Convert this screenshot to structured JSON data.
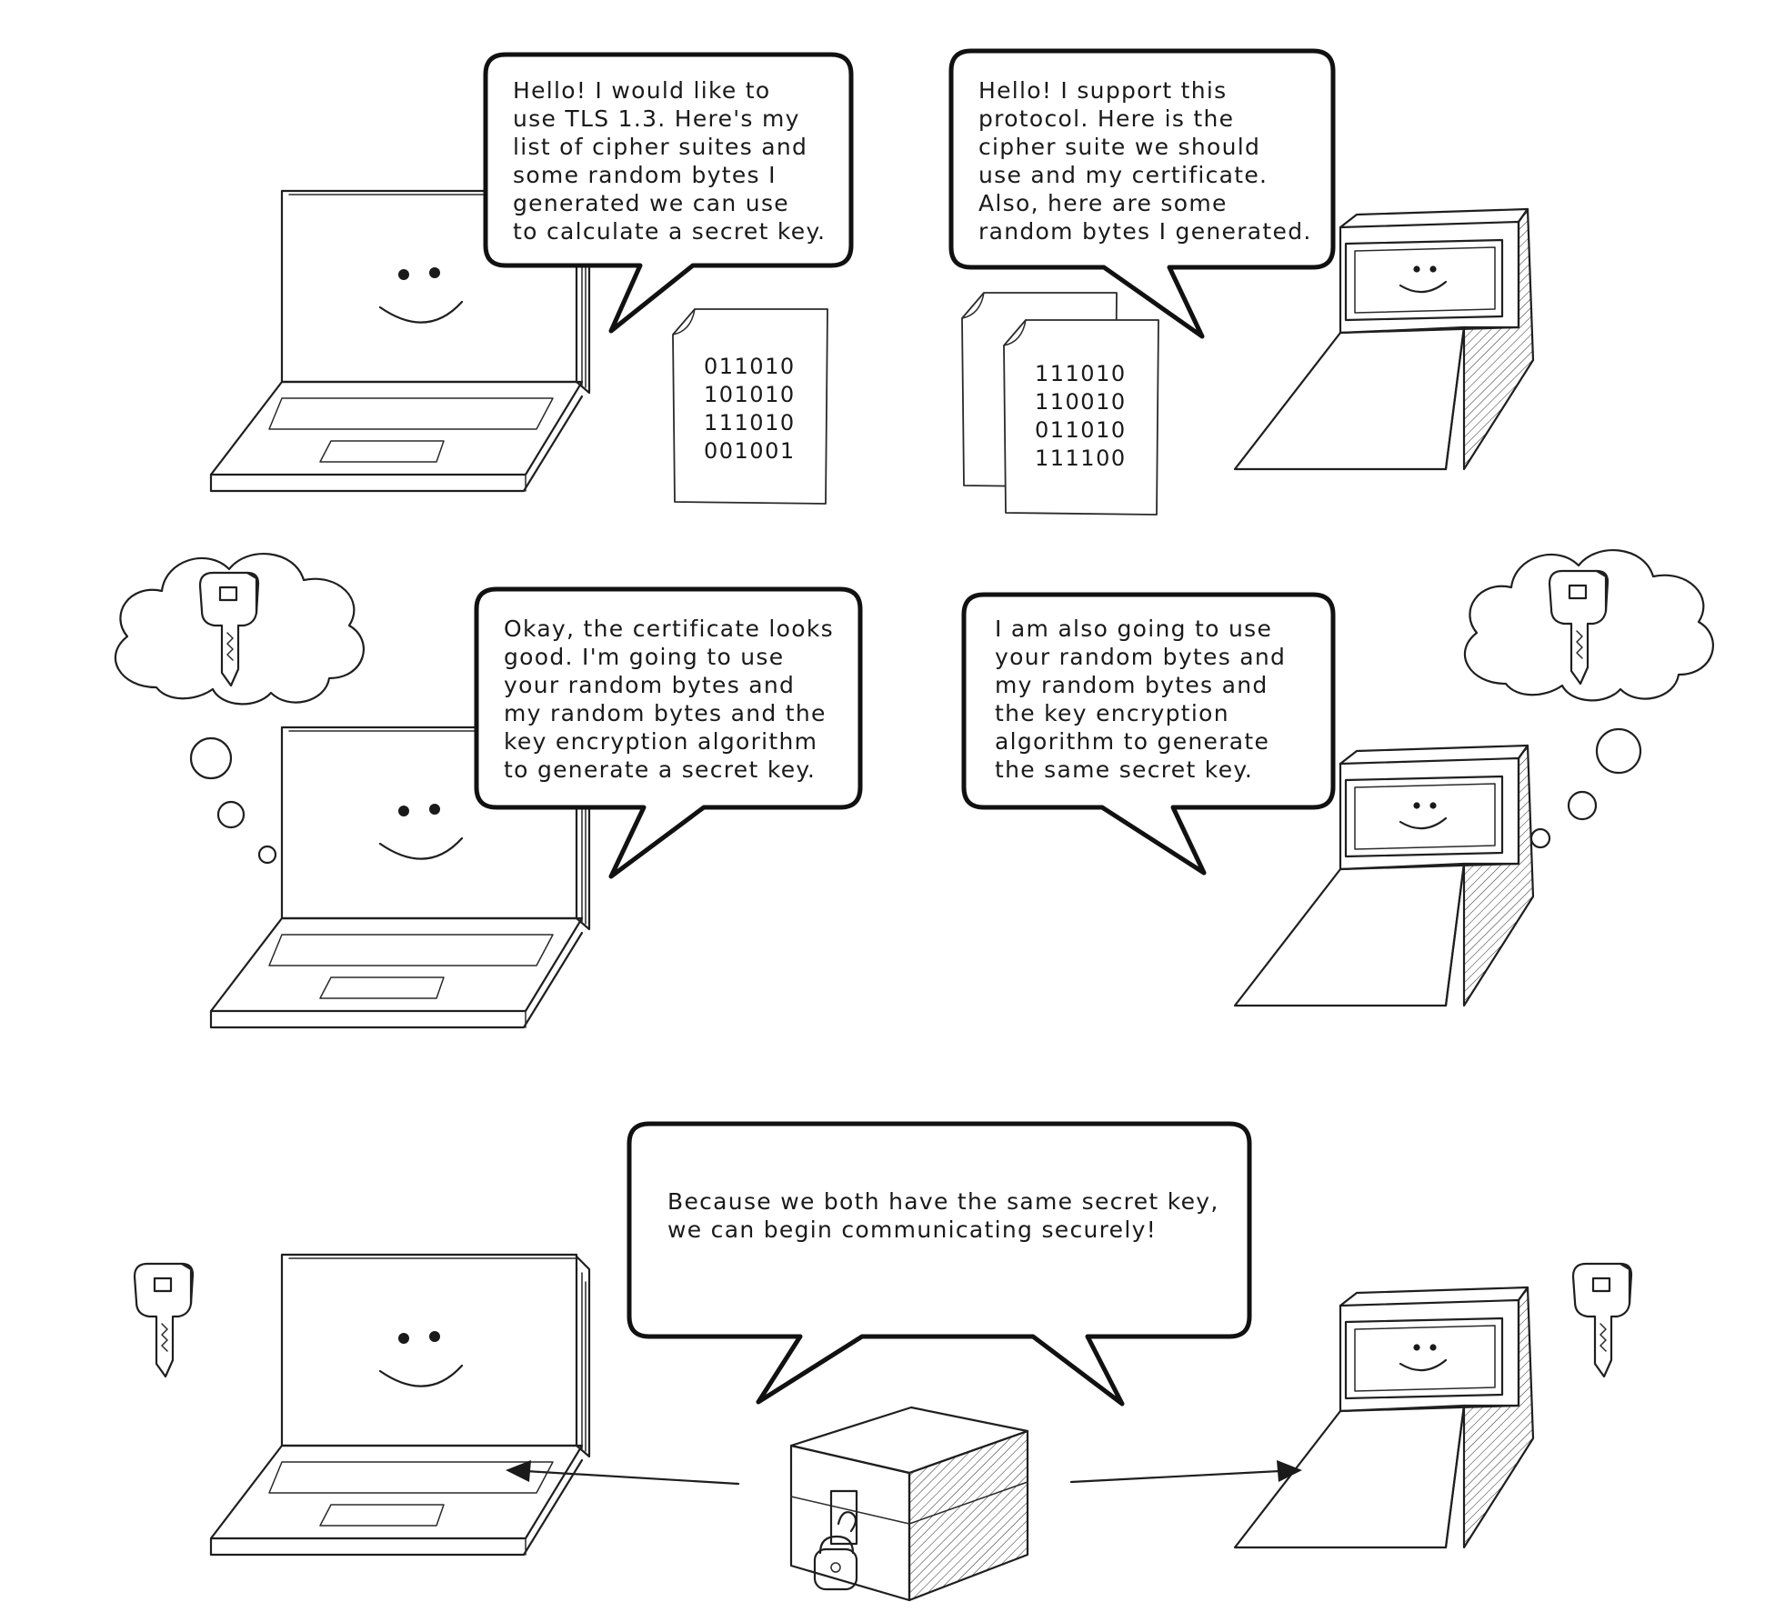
{
  "bubbles": {
    "client_hello": "Hello! I would like to\nuse TLS 1.3. Here's my\nlist of cipher suites and\nsome random bytes I\ngenerated we can use\nto calculate a secret key.",
    "server_hello": "Hello! I support this\nprotocol. Here is the\ncipher suite we should\nuse and my certificate.\nAlso, here are some\nrandom bytes I generated.",
    "client_key": "Okay, the certificate looks\ngood. I'm going to use\nyour random bytes and\nmy random bytes and the\nkey encryption algorithm\nto generate a secret key.",
    "server_key": "I am also going to use\nyour random bytes and\nmy random bytes and\nthe key encryption\nalgorithm to generate\nthe same secret key.",
    "shared": "Because we both have the same secret key,\nwe can begin communicating securely!"
  },
  "documents": {
    "client_random": "011010\n101010\n111010\n001001",
    "server_random": "111010\n110010\n011010\n111100"
  },
  "icons": {
    "client": "laptop-icon",
    "server": "server-icon",
    "key": "key-icon",
    "thought": "thought-cloud-icon",
    "lockbox": "locked-box-icon"
  }
}
